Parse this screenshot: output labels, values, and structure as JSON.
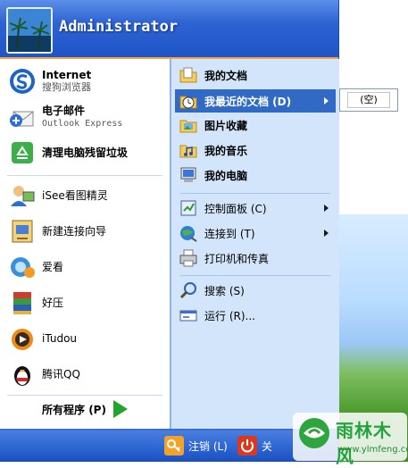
{
  "user": {
    "name": "Administrator"
  },
  "left_items": [
    {
      "label": "Internet",
      "sub": "搜狗浏览器",
      "icon": "sogou-browser-icon"
    },
    {
      "label": "电子邮件",
      "sub": "Outlook Express",
      "icon": "outlook-express-icon"
    },
    {
      "label": "清理电脑残留垃圾",
      "sub": "",
      "icon": "recycle-cleaner-icon"
    },
    {
      "label": "iSee看图精灵",
      "sub": "",
      "icon": "isee-viewer-icon"
    },
    {
      "label": "新建连接向导",
      "sub": "",
      "icon": "connection-wizard-icon"
    },
    {
      "label": "爱看",
      "sub": "",
      "icon": "aikan-icon"
    },
    {
      "label": "好压",
      "sub": "",
      "icon": "haozip-icon"
    },
    {
      "label": "iTudou",
      "sub": "",
      "icon": "itudou-icon"
    },
    {
      "label": "腾讯QQ",
      "sub": "",
      "icon": "qq-penguin-icon"
    }
  ],
  "all_programs": "所有程序 (P)",
  "right_items": [
    {
      "label": "我的文档",
      "icon": "my-documents-icon",
      "bold": true,
      "arrow": false
    },
    {
      "label": "我最近的文档 (D)",
      "icon": "recent-documents-icon",
      "bold": true,
      "arrow": true,
      "highlight": true
    },
    {
      "label": "图片收藏",
      "icon": "my-pictures-icon",
      "bold": true,
      "arrow": false
    },
    {
      "label": "我的音乐",
      "icon": "my-music-icon",
      "bold": true,
      "arrow": false
    },
    {
      "label": "我的电脑",
      "icon": "my-computer-icon",
      "bold": true,
      "arrow": false
    },
    {
      "label": "控制面板 (C)",
      "icon": "control-panel-icon",
      "bold": false,
      "arrow": true
    },
    {
      "label": "连接到 (T)",
      "icon": "connect-to-icon",
      "bold": false,
      "arrow": true
    },
    {
      "label": "打印机和传真",
      "icon": "printer-icon",
      "bold": false,
      "arrow": false
    },
    {
      "label": "搜索 (S)",
      "icon": "search-icon",
      "bold": false,
      "arrow": false
    },
    {
      "label": "运行 (R)...",
      "icon": "run-icon",
      "bold": false,
      "arrow": false
    }
  ],
  "submenu": {
    "empty_label": "(空)"
  },
  "footer": {
    "logoff": "注销 (L)",
    "shutdown": "关"
  },
  "watermark": {
    "name": "雨林木风",
    "url": "www.ylmfeng.com"
  },
  "colors": {
    "menu_blue": "#3a6ed5",
    "right_bg": "#d3e5fa",
    "highlight": "#316ac5",
    "accent_orange": "#f5a244"
  }
}
